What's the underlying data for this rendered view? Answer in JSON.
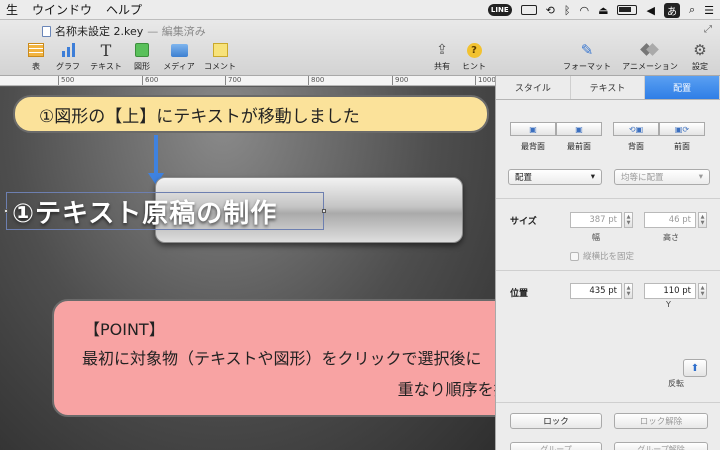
{
  "menubar": {
    "items": [
      "生",
      "ウインドウ",
      "ヘルプ"
    ],
    "status": {
      "line": "LINE",
      "input_method": "あ"
    }
  },
  "toolbar": {
    "document_title": "名称未設定 2.key",
    "document_status": "— 編集済み",
    "buttons": {
      "table": "表",
      "chart": "グラフ",
      "text": "テキスト",
      "shape": "図形",
      "media": "メディア",
      "comment": "コメント",
      "share": "共有",
      "hint": "ヒント",
      "format": "フォーマット",
      "animation": "アニメーション",
      "settings": "設定"
    }
  },
  "ruler": {
    "labels": [
      "500",
      "600",
      "700",
      "800",
      "900",
      "1000"
    ]
  },
  "canvas": {
    "top_callout": "①図形の【上】にテキストが移動しました",
    "selected_text": "①テキスト原稿の制作",
    "point_box": {
      "title": "【POINT】",
      "line1": "最初に対象物（テキストや図形）をクリックで選択後に",
      "line2": "重なり順序を指定する手順です。"
    }
  },
  "inspector": {
    "tabs": [
      {
        "label": "スタイル",
        "active": false
      },
      {
        "label": "テキスト",
        "active": false
      },
      {
        "label": "配置",
        "active": true
      }
    ],
    "arrange": {
      "back_most": "最背面",
      "front_most": "最前面",
      "backward": "背面",
      "forward": "前面"
    },
    "align_dropdown": "配置",
    "distribute_dropdown": "均等に配置",
    "size": {
      "label": "サイズ",
      "width": "387 pt",
      "height": "46 pt",
      "width_label": "幅",
      "height_label": "高さ",
      "constrain": "縦横比を固定"
    },
    "position": {
      "label": "位置",
      "x": "435 pt",
      "y": "110 pt",
      "y_label": "Y"
    },
    "flip_label": "反転",
    "lock": "ロック",
    "unlock": "ロック解除",
    "group": "グループ",
    "ungroup": "グループ解除"
  }
}
